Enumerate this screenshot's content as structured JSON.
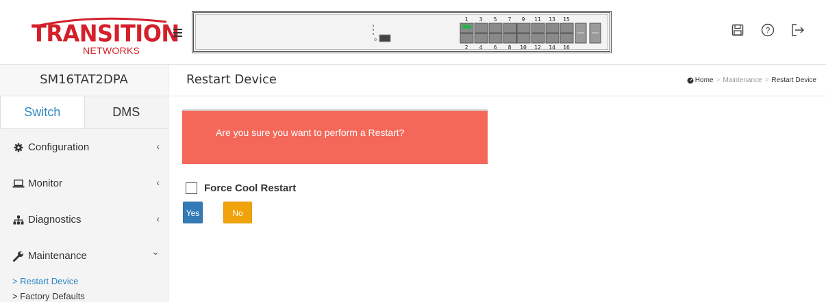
{
  "brand": {
    "logo_main": "TRANSITION",
    "logo_sub": "NETWORKS",
    "logo_color": "#d3202a"
  },
  "switch_panel": {
    "top_port_labels": [
      "1",
      "3",
      "5",
      "7",
      "9",
      "11",
      "13",
      "15"
    ],
    "bottom_port_labels": [
      "2",
      "4",
      "6",
      "8",
      "10",
      "12",
      "14",
      "16"
    ],
    "active_port": "1"
  },
  "header_icons": [
    "save-icon",
    "help-icon",
    "logout-icon"
  ],
  "sidebar": {
    "device_name": "SM16TAT2DPA",
    "tabs": [
      {
        "label": "Switch",
        "active": true
      },
      {
        "label": "DMS",
        "active": false
      }
    ],
    "menu": [
      {
        "label": "Configuration",
        "icon": "gear-icon",
        "chevron": "‹"
      },
      {
        "label": "Monitor",
        "icon": "laptop-icon",
        "chevron": "‹"
      },
      {
        "label": "Diagnostics",
        "icon": "sitemap-icon",
        "chevron": "‹"
      },
      {
        "label": "Maintenance",
        "icon": "wrench-icon",
        "chevron": "⌄"
      }
    ],
    "submenu": [
      {
        "label": "> Restart Device",
        "active": true
      },
      {
        "label": "> Factory Defaults",
        "active": false
      }
    ]
  },
  "main": {
    "title": "Restart Device",
    "breadcrumb": {
      "home": "Home",
      "separator": ">",
      "middle": "Maintenance",
      "current": "Restart Device"
    },
    "alert_text": "Are you sure you want to perform a Restart?",
    "alert_color": "#f4685a",
    "force_cool_label": "Force Cool Restart",
    "force_cool_checked": false,
    "yes_label": "Yes",
    "no_label": "No",
    "accent_color": "#2c88c4"
  }
}
